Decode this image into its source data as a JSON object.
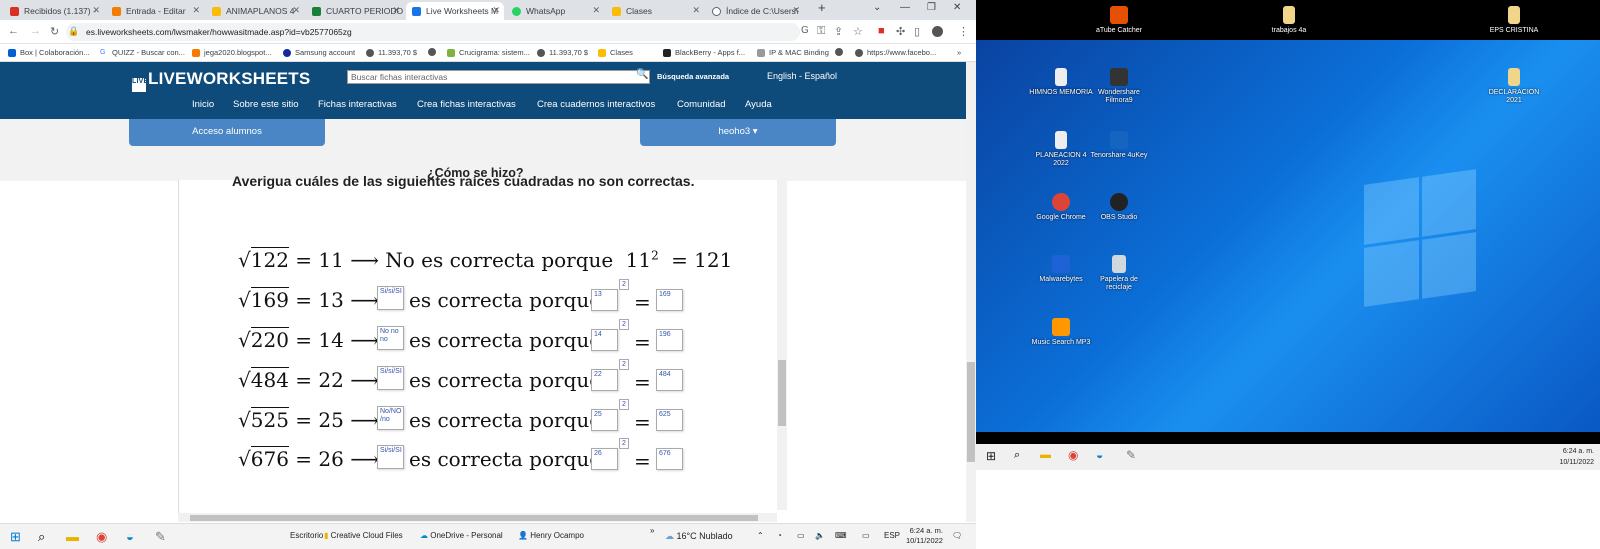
{
  "tabs": [
    {
      "label": "Recibidos (1.137) -",
      "color": "#d93025"
    },
    {
      "label": "Entrada - Editar",
      "color": "#f57c00"
    },
    {
      "label": "ANIMAPLANOS 4",
      "color": "#fbbc04"
    },
    {
      "label": "CUARTO PERIODO",
      "color": "#188038"
    },
    {
      "label": "Live Worksheets M",
      "color": "#1a73e8"
    },
    {
      "label": "WhatsApp",
      "color": "#25d366"
    },
    {
      "label": "Clases",
      "color": "#fbbc04"
    },
    {
      "label": "Índice de C:\\Users\\",
      "color": "#5f6368"
    }
  ],
  "url": "es.liveworksheets.com/lwsmaker/howwasitmade.asp?id=vb2577065zg",
  "bookmarks": [
    "Box | Colaboración...",
    "QUIZZ - Buscar con...",
    "jega2020.blogspot...",
    "Samsung account",
    "11.393,70 $",
    "Crucigrama: sistem...",
    "11.393,70 $",
    "Clases",
    "BlackBerry - Apps f...",
    "IP & MAC Binding",
    "https://www.facebo..."
  ],
  "site": {
    "logo": "LIVEWORKSHEETS",
    "logo_mark": "LIVE",
    "search_placeholder": "Buscar fichas interactivas",
    "advanced": "Búsqueda avanzada",
    "lang": "English - Español",
    "menu": [
      "Inicio",
      "Sobre este sitio",
      "Fichas interactivas",
      "Crea fichas interactivas",
      "Crea cuadernos interactivos",
      "Comunidad",
      "Ayuda"
    ],
    "students_btn": "Acceso alumnos",
    "user_btn": "heoho3 ▾",
    "how_made": "¿Cómo se hizo?"
  },
  "worksheet": {
    "instruction": "Averigua cuáles de las siguientes raíces cuadradas no son correctas.",
    "rows": [
      {
        "radicand": "122",
        "eq": "= 11 ⟶",
        "text": "No es correcta porque",
        "base": "11",
        "exp": "2",
        "result": "= 121",
        "answer": "",
        "box_base": "",
        "box_exp": "",
        "box_result": ""
      },
      {
        "radicand": "169",
        "eq": "= 13 ⟶",
        "text": "es correcta porque",
        "answer": "Si/si/SI",
        "box_base": "13",
        "box_exp": "2",
        "box_result": "169"
      },
      {
        "radicand": "220",
        "eq": "= 14 ⟶",
        "text": "es correcta porque",
        "answer": "No no no",
        "box_base": "14",
        "box_exp": "2",
        "box_result": "196"
      },
      {
        "radicand": "484",
        "eq": "= 22 ⟶",
        "text": "es correcta porque",
        "answer": "Si/si/SI",
        "box_base": "22",
        "box_exp": "2",
        "box_result": "484"
      },
      {
        "radicand": "525",
        "eq": "= 25 ⟶",
        "text": "es correcta porque",
        "answer": "No/NO /no",
        "box_base": "25",
        "box_exp": "2",
        "box_result": "625"
      },
      {
        "radicand": "676",
        "eq": "= 26 ⟶",
        "text": "es correcta porque",
        "answer": "Si/si/SI",
        "box_base": "26",
        "box_exp": "2",
        "box_result": "676"
      }
    ],
    "equals": "="
  },
  "taskbar_left": {
    "desktop": "Escritorio",
    "cc": "Creative Cloud Files",
    "onedrive": "OneDrive - Personal",
    "user": "Henry Ocampo",
    "weather": "16°C  Nublado",
    "lang": "ESP",
    "time": "6:24 a. m.",
    "date": "10/11/2022"
  },
  "desktop": {
    "icons": [
      {
        "label": "aTube Catcher",
        "color": "#e65100"
      },
      {
        "label": "trabajos 4a",
        "color": "#f0d58a"
      },
      {
        "label": "EPS CRISTINA",
        "color": "#f0d58a"
      },
      {
        "label": "HIMNOS MEMORIA",
        "color": "#eeeeee"
      },
      {
        "label": "Wondershare Filmora9",
        "color": "#333333"
      },
      {
        "label": "DECLARACION 2021",
        "color": "#f0d58a"
      },
      {
        "label": "PLANEACION 4 2022",
        "color": "#eeeeee"
      },
      {
        "label": "Tenorshare 4uKey",
        "color": "#1565c0"
      },
      {
        "label": "Google Chrome",
        "color": "#db4437"
      },
      {
        "label": "OBS Studio",
        "color": "#222222"
      },
      {
        "label": "Malwarebytes",
        "color": "#1e63d6"
      },
      {
        "label": "Papelera de reciclaje",
        "color": "#cfd8dc"
      },
      {
        "label": "Music Search MP3",
        "color": "#ff9800"
      }
    ],
    "time": "6:24 a. m.",
    "date": "10/11/2022"
  }
}
